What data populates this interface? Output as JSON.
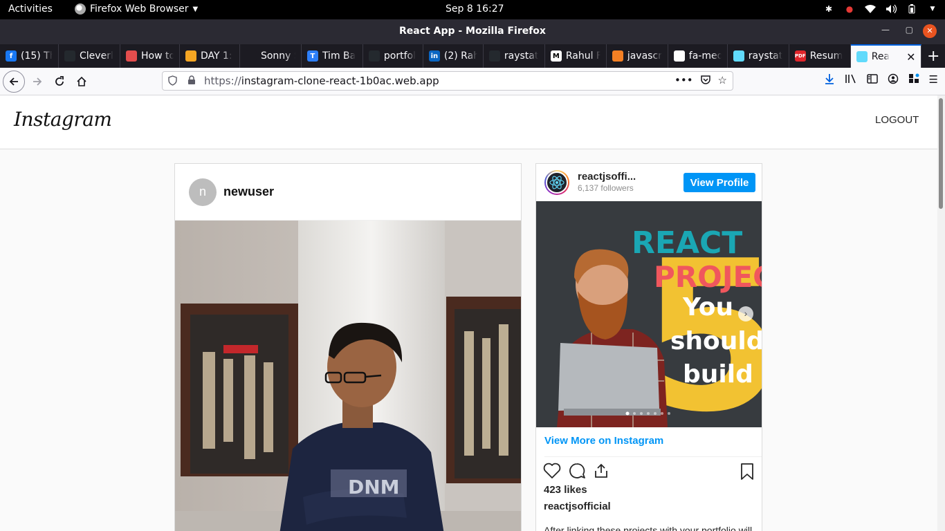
{
  "system": {
    "activities": "Activities",
    "app_menu": "Firefox Web Browser",
    "clock": "Sep 8  16:27"
  },
  "window": {
    "title": "React App - Mozilla Firefox"
  },
  "tabs": [
    {
      "label": "(15) Th",
      "fav_color": "#1877f2",
      "fav_text": "f"
    },
    {
      "label": "Cleverl",
      "fav_color": "#24292e",
      "fav_text": ""
    },
    {
      "label": "How to",
      "fav_color": "#e44d4d",
      "fav_text": ""
    },
    {
      "label": "DAY 1:",
      "fav_color": "#f5a623",
      "fav_text": ""
    },
    {
      "label": "Sonny San",
      "fav_color": "#1c1b22",
      "fav_text": ""
    },
    {
      "label": "Tim Ba",
      "fav_color": "#2d7ff9",
      "fav_text": "T"
    },
    {
      "label": "portfol",
      "fav_color": "#24292e",
      "fav_text": ""
    },
    {
      "label": "(2) Rah",
      "fav_color": "#0a66c2",
      "fav_text": "in"
    },
    {
      "label": "raystat",
      "fav_color": "#24292e",
      "fav_text": ""
    },
    {
      "label": "Rahul F",
      "fav_color": "#ffffff",
      "fav_text": "M"
    },
    {
      "label": "javascr",
      "fav_color": "#f48024",
      "fav_text": ""
    },
    {
      "label": "fa-med",
      "fav_color": "#ffffff",
      "fav_text": ""
    },
    {
      "label": "raystat",
      "fav_color": "#61dafb",
      "fav_text": ""
    },
    {
      "label": "Resum",
      "fav_color": "#e0252b",
      "fav_text": "PDF"
    },
    {
      "label": "Rea",
      "fav_color": "#61dafb",
      "fav_text": "",
      "active": true
    }
  ],
  "navbar": {
    "url_protocol": "https://",
    "url_host": "instagram-clone-react-1b0ac.web.app"
  },
  "ig": {
    "logo": "Instagram",
    "logout": "LOGOUT"
  },
  "post": {
    "avatar_letter": "n",
    "username": "newuser"
  },
  "embed": {
    "name": "reactjsoffi...",
    "followers": "6,137 followers",
    "view_profile": "View Profile",
    "image_lines": [
      "REACT",
      "PROJECT",
      "You",
      "should",
      "build"
    ],
    "image_number": "5",
    "view_more": "View More on Instagram",
    "likes": "423 likes",
    "owner": "reactjsofficial",
    "caption": "After linking these projects with your portfolio will"
  },
  "colors": {
    "ig_blue": "#0095f6",
    "firefox_accent": "#0060df",
    "ubuntu_orange": "#e95420"
  }
}
